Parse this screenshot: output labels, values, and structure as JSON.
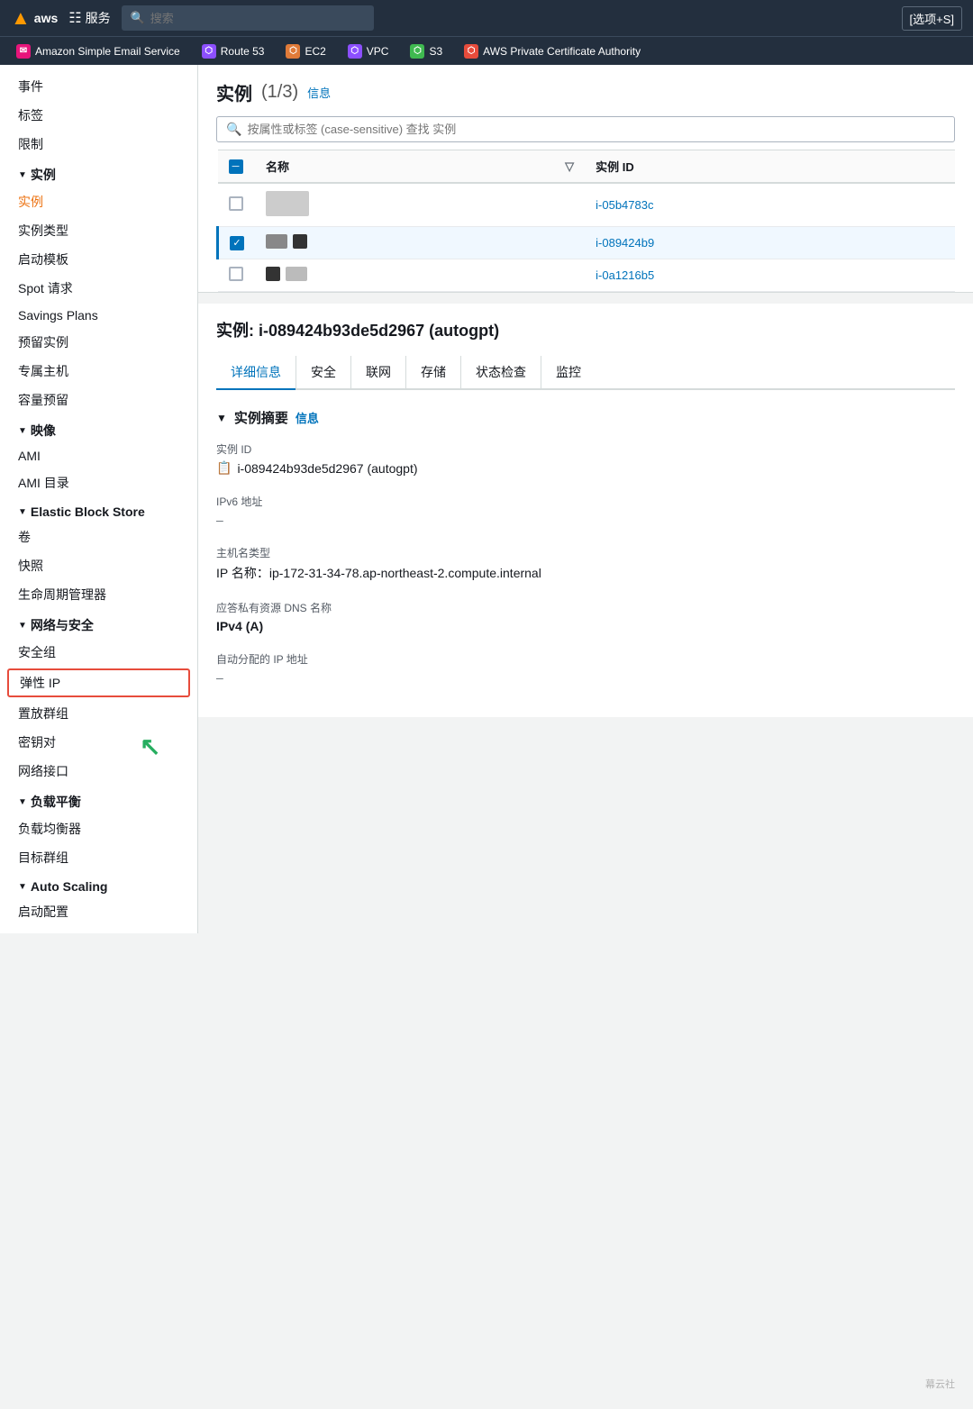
{
  "topnav": {
    "logo": "aws",
    "services_label": "服务",
    "search_placeholder": "搜索",
    "options_label": "[选项+S]"
  },
  "services_bar": {
    "items": [
      {
        "id": "ses",
        "label": "Amazon Simple Email Service",
        "color": "#e7157b",
        "icon": "✉"
      },
      {
        "id": "route53",
        "label": "Route 53",
        "color": "#8c4fff",
        "icon": "⬡"
      },
      {
        "id": "ec2",
        "label": "EC2",
        "color": "#e07b39",
        "icon": "⬡"
      },
      {
        "id": "vpc",
        "label": "VPC",
        "color": "#8c4fff",
        "icon": "⬡"
      },
      {
        "id": "s3",
        "label": "S3",
        "color": "#3fb950",
        "icon": "⬡"
      },
      {
        "id": "pca",
        "label": "AWS Private Certificate Authority",
        "color": "#e74c3c",
        "icon": "⬡"
      }
    ]
  },
  "sidebar": {
    "top_items": [
      {
        "id": "events",
        "label": "事件",
        "active": false
      },
      {
        "id": "tags",
        "label": "标签",
        "active": false
      },
      {
        "id": "limits",
        "label": "限制",
        "active": false
      }
    ],
    "sections": [
      {
        "id": "instances-section",
        "title": "实例",
        "expanded": true,
        "items": [
          {
            "id": "instances",
            "label": "实例",
            "active": true
          },
          {
            "id": "instance-types",
            "label": "实例类型",
            "active": false
          },
          {
            "id": "launch-templates",
            "label": "启动模板",
            "active": false
          },
          {
            "id": "spot-requests",
            "label": "Spot 请求",
            "active": false
          },
          {
            "id": "savings-plans",
            "label": "Savings Plans",
            "active": false
          },
          {
            "id": "reserved-instances",
            "label": "预留实例",
            "active": false
          },
          {
            "id": "dedicated-hosts",
            "label": "专属主机",
            "active": false
          },
          {
            "id": "capacity-reservations",
            "label": "容量预留",
            "active": false
          }
        ]
      },
      {
        "id": "images-section",
        "title": "映像",
        "expanded": true,
        "items": [
          {
            "id": "ami",
            "label": "AMI",
            "active": false
          },
          {
            "id": "ami-catalog",
            "label": "AMI 目录",
            "active": false
          }
        ]
      },
      {
        "id": "ebs-section",
        "title": "Elastic Block Store",
        "expanded": true,
        "items": [
          {
            "id": "volumes",
            "label": "卷",
            "active": false
          },
          {
            "id": "snapshots",
            "label": "快照",
            "active": false
          },
          {
            "id": "lifecycle-manager",
            "label": "生命周期管理器",
            "active": false
          }
        ]
      },
      {
        "id": "network-section",
        "title": "网络与安全",
        "expanded": true,
        "items": [
          {
            "id": "security-groups",
            "label": "安全组",
            "active": false
          },
          {
            "id": "elastic-ip",
            "label": "弹性 IP",
            "active": false,
            "highlighted": true
          },
          {
            "id": "placement-groups",
            "label": "置放群组",
            "active": false
          },
          {
            "id": "key-pairs",
            "label": "密钥对",
            "active": false
          },
          {
            "id": "network-interfaces",
            "label": "网络接口",
            "active": false
          }
        ]
      },
      {
        "id": "loadbalancing-section",
        "title": "负载平衡",
        "expanded": true,
        "items": [
          {
            "id": "load-balancers",
            "label": "负载均衡器",
            "active": false
          },
          {
            "id": "target-groups",
            "label": "目标群组",
            "active": false
          }
        ]
      },
      {
        "id": "autoscaling-section",
        "title": "Auto Scaling",
        "expanded": true,
        "items": [
          {
            "id": "auto-scaling-groups",
            "label": "启动配置",
            "active": false
          }
        ]
      }
    ]
  },
  "instance_list": {
    "title": "实例",
    "count_label": "(1/3)",
    "info_label": "信息",
    "search_placeholder": "按属性或标签 (case-sensitive) 查找 实例",
    "table": {
      "columns": [
        {
          "id": "checkbox",
          "label": ""
        },
        {
          "id": "name",
          "label": "名称"
        },
        {
          "id": "filter_icon",
          "label": ""
        },
        {
          "id": "instance_id",
          "label": "实例 ID"
        }
      ],
      "rows": [
        {
          "id": "row1",
          "checkbox": false,
          "instance_id": "i-05b4783c",
          "selected": false
        },
        {
          "id": "row2",
          "checkbox": true,
          "instance_id": "i-089424b9",
          "selected": true
        },
        {
          "id": "row3",
          "checkbox": false,
          "instance_id": "i-0a1216b5",
          "selected": false
        }
      ]
    }
  },
  "instance_detail": {
    "title": "实例: i-089424b93de5d2967 (autogpt)",
    "tabs": [
      {
        "id": "details",
        "label": "详细信息",
        "active": true
      },
      {
        "id": "security",
        "label": "安全",
        "active": false
      },
      {
        "id": "networking",
        "label": "联网",
        "active": false
      },
      {
        "id": "storage",
        "label": "存储",
        "active": false
      },
      {
        "id": "status-checks",
        "label": "状态检查",
        "active": false
      },
      {
        "id": "monitoring",
        "label": "监控",
        "active": false
      }
    ],
    "summary": {
      "header": "实例摘要",
      "info_label": "信息",
      "fields": [
        {
          "id": "instance-id",
          "label": "实例 ID",
          "value": "i-089424b93de5d2967 (autogpt)",
          "has_copy": true
        },
        {
          "id": "ipv6",
          "label": "IPv6 地址",
          "value": "–",
          "has_copy": false
        },
        {
          "id": "hostname-type",
          "label": "主机名类型",
          "value": "IP 名称：ip-172-31-34-78.ap-northeast-2.compute.internal",
          "has_copy": false
        },
        {
          "id": "private-dns",
          "label": "应答私有资源 DNS 名称",
          "value": "IPv4 (A)",
          "has_copy": false,
          "bold": true
        },
        {
          "id": "auto-ip",
          "label": "自动分配的 IP 地址",
          "value": "–",
          "has_copy": false
        }
      ]
    }
  },
  "watermark": "幕云社"
}
